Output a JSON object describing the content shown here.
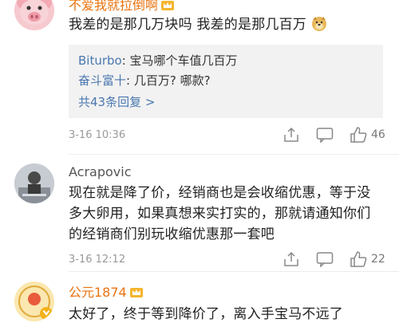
{
  "comments": [
    {
      "user": "不爱我就拉倒啊",
      "text": "我差的是那几万块吗 我差的是那几百万",
      "replies": [
        {
          "user": "Biturbo",
          "sep": ": ",
          "text": "宝马哪个车值几百万"
        },
        {
          "user": "奋斗富十",
          "sep": ": ",
          "text": "几百万? 哪款?"
        }
      ],
      "more_replies": "共43条回复 >",
      "date": "3-16 10:36",
      "likes": "46",
      "emoji": "doge-emoji"
    },
    {
      "user": "Acrapovic",
      "text_lines": [
        "现在就是降了价，经销商也是会收缩优惠，等于没",
        "多大卵用，如果真想来实打实的，那就请通知你们",
        "的经销商们别玩收缩优惠那一套吧"
      ],
      "date": "3-16 12:12",
      "likes": "22"
    },
    {
      "user": "公元1874",
      "text": "太好了，终于等到降价了，离入手宝马不远了"
    }
  ],
  "colors": {
    "vip_name": "#e8730f",
    "link_blue": "#4a78b0",
    "meta_gray": "#999999",
    "reply_bg": "#f2f2f2"
  }
}
